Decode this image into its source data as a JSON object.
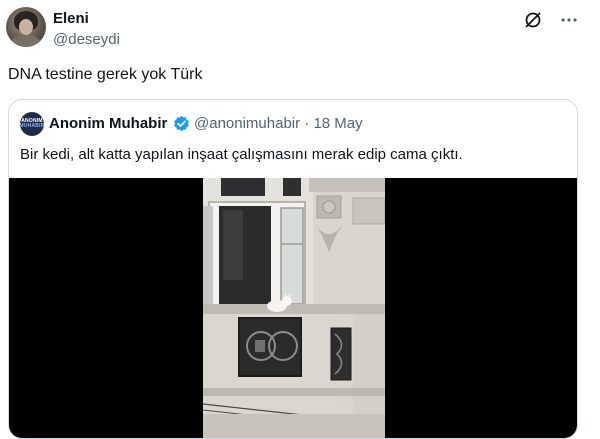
{
  "author": {
    "name": "Eleni",
    "handle": "@deseydi"
  },
  "post": {
    "text": "DNA testine gerek yok Türk"
  },
  "actions": {
    "grok_icon": "grok-icon",
    "more_icon": "more-icon"
  },
  "quote": {
    "avatar_text_top": "ANONIM",
    "avatar_text_bottom": "MUHABIR",
    "name": "Anonim Muhabir",
    "verified_icon": "verified-badge-icon",
    "handle_date": "@anonimuhabir · 18 May",
    "text": "Bir kedi, alt katta yapılan inşaat çalışmasını merak edip cama çıktı."
  },
  "colors": {
    "text": "#0f1419",
    "secondary": "#536471",
    "border": "#cfd9de",
    "verified": "#1d9bf0",
    "media_bg": "#000000"
  }
}
